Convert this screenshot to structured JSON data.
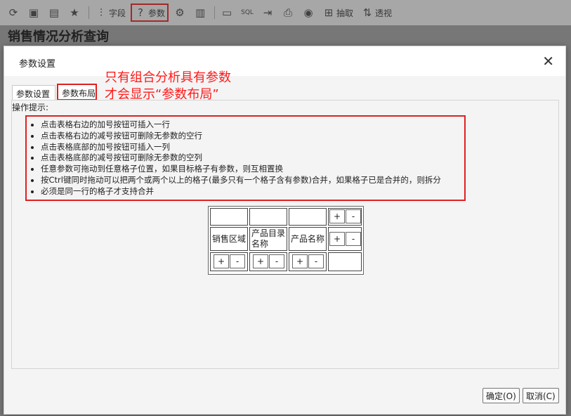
{
  "toolbar": {
    "fields_label": "字段",
    "params_label": "参数",
    "extract_label": "抽取",
    "pivot_label": "透视"
  },
  "report_title": "销售情况分析查询",
  "dialog": {
    "title": "参数设置",
    "annotation_line1": "只有组合分析具有参数",
    "annotation_line2": "才会显示“参数布局”",
    "tabs": [
      "参数设置",
      "参数布局"
    ],
    "hint_label": "操作提示:",
    "hints": [
      "点击表格右边的加号按钮可插入一行",
      "点击表格右边的减号按钮可删除无参数的空行",
      "点击表格底部的加号按钮可插入一列",
      "点击表格底部的减号按钮可删除无参数的空列",
      "任意参数可拖动到任意格子位置，如果目标格子有参数，则互相置换",
      "按Ctrl键同时拖动可以把两个或两个以上的格子(最多只有一个格子含有参数)合并，如果格子已是合并的，则拆分",
      "必须是同一行的格子才支持合并"
    ],
    "grid": {
      "row2": [
        "销售区域",
        "产品目录名称",
        "产品名称"
      ],
      "plus": "+",
      "minus": "-"
    },
    "ok_label": "确定(O)",
    "cancel_label": "取消(C)"
  },
  "colors": {
    "highlight": "#e02020",
    "annotation": "#ff1a1a"
  }
}
